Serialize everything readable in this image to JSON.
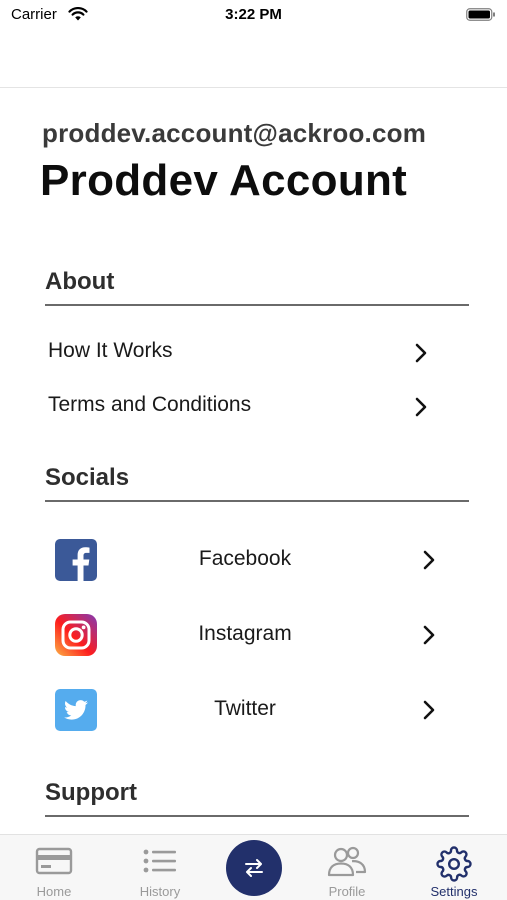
{
  "status_bar": {
    "carrier": "Carrier",
    "time": "3:22 PM",
    "wifi_icon": "wifi-icon",
    "battery_icon": "battery-icon"
  },
  "profile": {
    "email": "proddev.account@ackroo.com",
    "name": "Proddev Account"
  },
  "about": {
    "title": "About",
    "items": [
      {
        "label": "How It Works",
        "icon": "chevron-right-icon"
      },
      {
        "label": "Terms and Conditions",
        "icon": "chevron-right-icon"
      }
    ]
  },
  "socials": {
    "title": "Socials",
    "items": [
      {
        "label": "Facebook",
        "icon": "facebook-logo-icon"
      },
      {
        "label": "Instagram",
        "icon": "instagram-logo-icon"
      },
      {
        "label": "Twitter",
        "icon": "twitter-logo-icon"
      }
    ]
  },
  "support": {
    "title": "Support"
  },
  "tab_bar": {
    "tabs": [
      {
        "label": "Home",
        "icon": "card-icon",
        "active": false
      },
      {
        "label": "History",
        "icon": "list-icon",
        "active": false
      },
      {
        "label": "Profile",
        "icon": "users-icon",
        "active": false
      },
      {
        "label": "Settings",
        "icon": "gear-icon",
        "active": true
      }
    ],
    "center_button_icon": "swap-arrows-icon"
  },
  "colors": {
    "accent": "#22306b",
    "inactive_tab": "#9a9a9a",
    "divider": "#6a6a6a",
    "facebook": "#3b5998",
    "twitter": "#55acee"
  }
}
